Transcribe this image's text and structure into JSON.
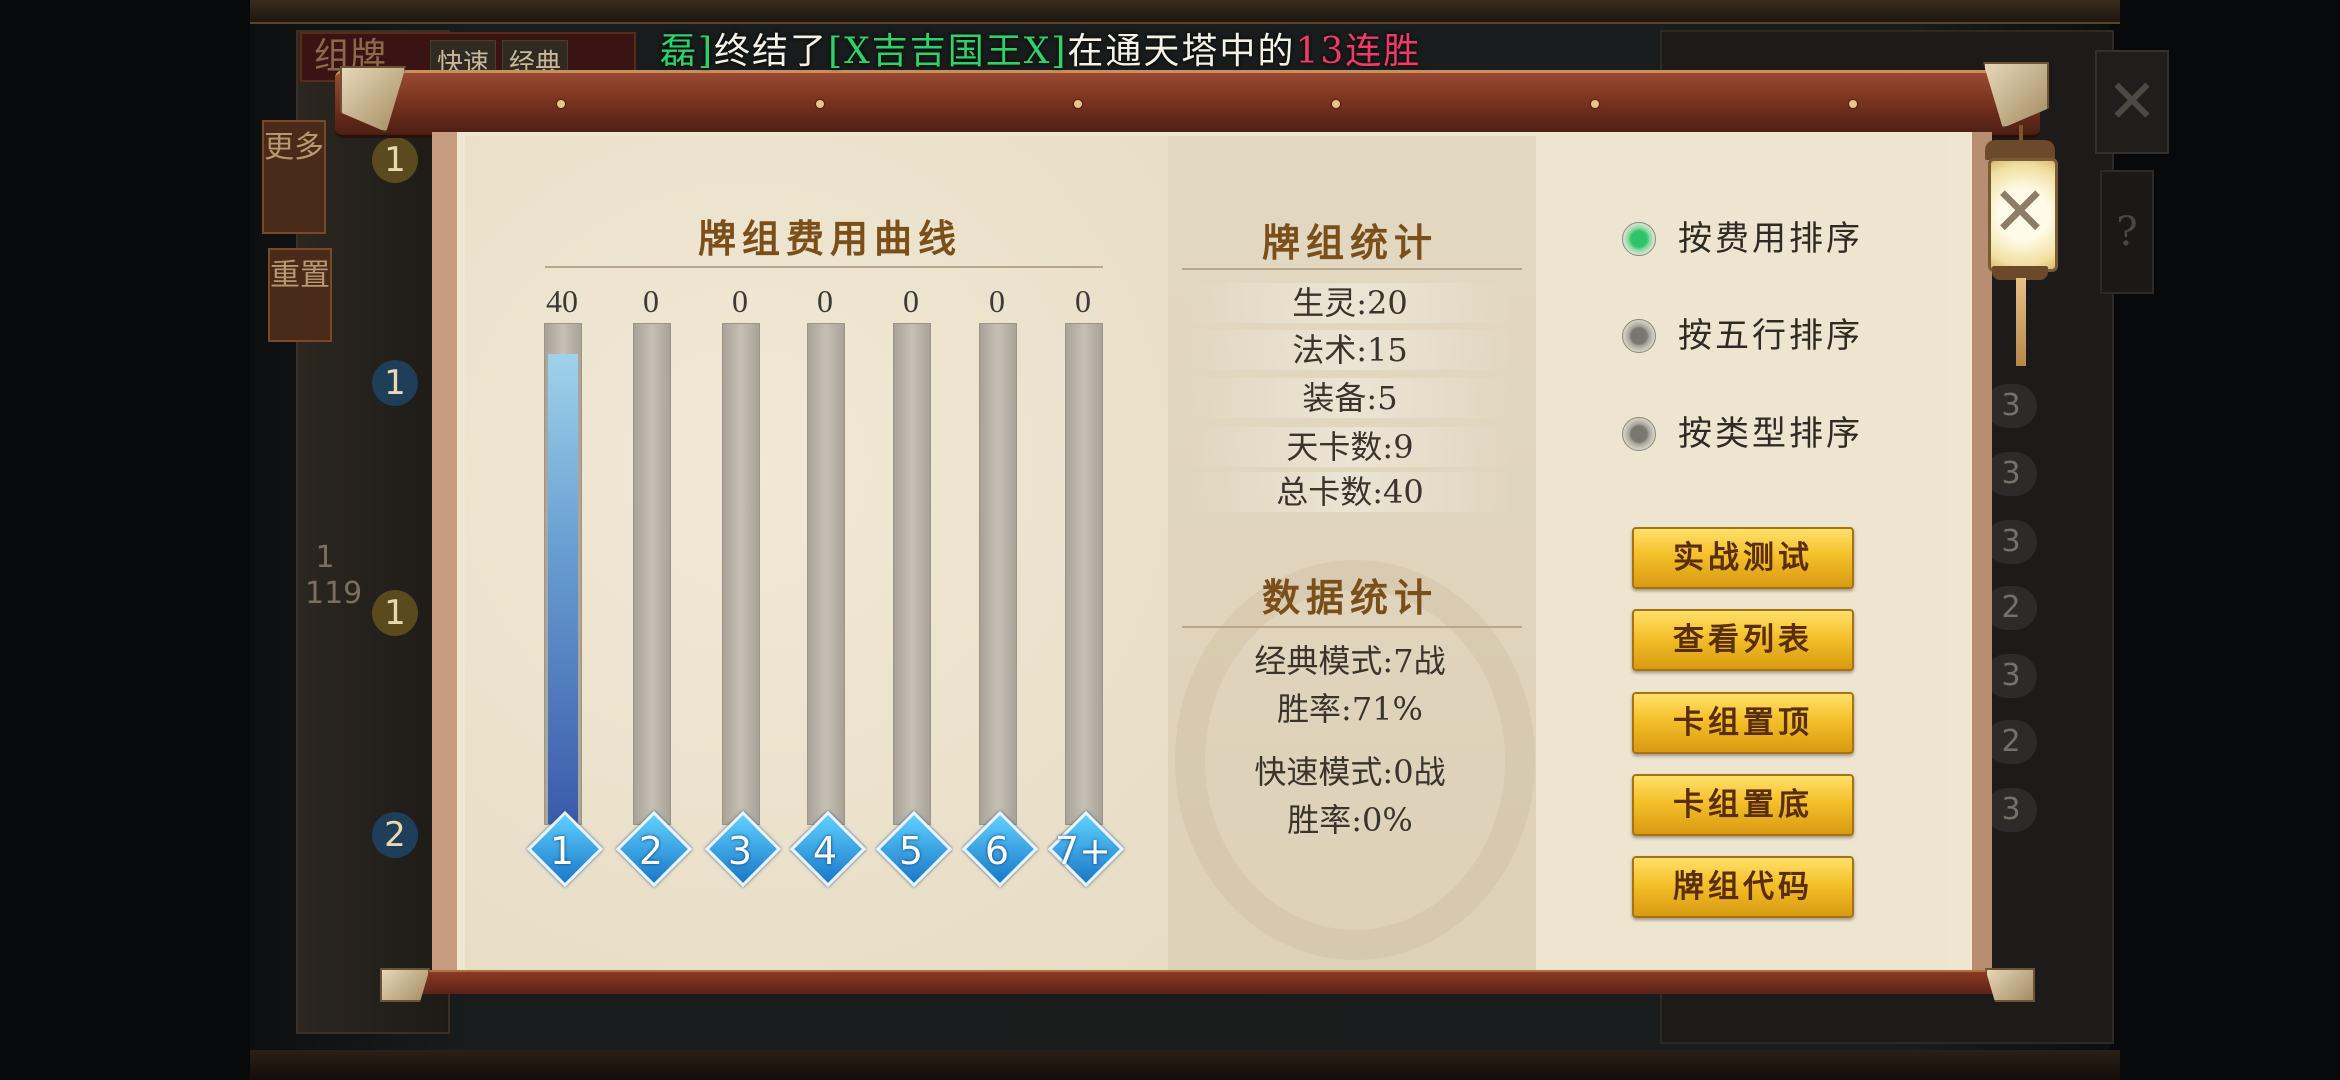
{
  "broadcast": {
    "prefix": "磊]",
    "middle1": "终结了",
    "player": "[X吉吉国王X]",
    "middle2": "在通天塔中的",
    "streak": "13连胜"
  },
  "background": {
    "title": "组牌",
    "tabs": [
      "快速",
      "经典"
    ],
    "side_buttons": [
      "更多",
      "重置"
    ],
    "page_current": "1",
    "page_total": "119",
    "left_badges": [
      "1",
      "1",
      "1",
      "2"
    ],
    "right_costs": [
      "3",
      "3",
      "3",
      "2",
      "3",
      "2",
      "3"
    ],
    "close_glyph": "✕",
    "help_glyph": "?"
  },
  "cost_curve": {
    "title": "牌组费用曲线",
    "bars": [
      {
        "label": "1",
        "count": "40",
        "value": 40
      },
      {
        "label": "2",
        "count": "0",
        "value": 0
      },
      {
        "label": "3",
        "count": "0",
        "value": 0
      },
      {
        "label": "4",
        "count": "0",
        "value": 0
      },
      {
        "label": "5",
        "count": "0",
        "value": 0
      },
      {
        "label": "6",
        "count": "0",
        "value": 0
      },
      {
        "label": "7+",
        "count": "0",
        "value": 0
      }
    ],
    "max_value": 40,
    "fill_color": "#6aa0d2"
  },
  "deck_stats": {
    "title": "牌组统计",
    "rows": [
      "生灵:20",
      "法术:15",
      "装备:5",
      "天卡数:9",
      "总卡数:40"
    ]
  },
  "data_stats": {
    "title": "数据统计",
    "classic_games": "经典模式:7战",
    "classic_winrate": "胜率:71%",
    "quick_games": "快速模式:0战",
    "quick_winrate": "胜率:0%"
  },
  "sort_options": [
    {
      "label": "按费用排序",
      "selected": true
    },
    {
      "label": "按五行排序",
      "selected": false
    },
    {
      "label": "按类型排序",
      "selected": false
    }
  ],
  "actions": [
    "实战测试",
    "查看列表",
    "卡组置顶",
    "卡组置底",
    "牌组代码"
  ],
  "close_icon": "lantern-close-icon",
  "close_glyph": "✕",
  "colors": {
    "accent_gold": "#f4c02a",
    "title_brown": "#7a4f1a",
    "selected_green": "#2fc46a",
    "broadcast_green": "#2dd36a",
    "broadcast_red": "#f03a6a"
  }
}
